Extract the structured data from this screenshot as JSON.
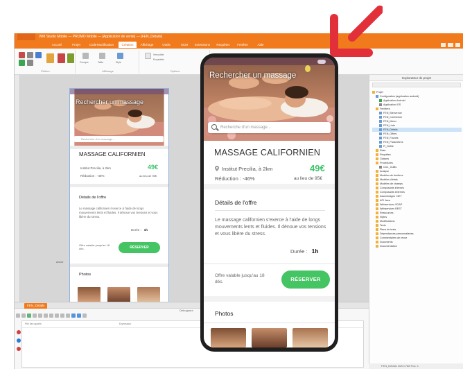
{
  "ide": {
    "window_title": "WM Studio Mobile — PROMO Mobile — [Application de vente] — [FEN_Détails]",
    "ribbon_tabs": [
      "Accueil",
      "Projet",
      "Code",
      "Modification",
      "Création",
      "Affichage",
      "Outils",
      "SCM",
      "Extensions",
      "Requêtes",
      "Fenêtre",
      "Aide"
    ],
    "ribbon_groups": [
      "Édition",
      "Affichage",
      "Mode",
      "Options"
    ],
    "ribbon_items": [
      "Aligner",
      "Distribuer",
      "Ordre",
      "Ancres",
      "Grouper",
      "Taille",
      "Style",
      "Verrouiller",
      "Propriétés",
      "Modèle"
    ],
    "anchor_label": "Ancre",
    "bottom_tab": "FEN_Détails",
    "debugger_label": "Débogueur",
    "code_columns": [
      "Pile des appels",
      "Expression",
      "Valeur"
    ],
    "status_text": "FEN_Détails   1024×768  Pos: 1"
  },
  "explorer": {
    "title": "Explorateur de projet",
    "tree": [
      {
        "label": "Projet",
        "indent": 0,
        "color": "#f0b23c"
      },
      {
        "label": "Configuration (application android)",
        "indent": 1,
        "color": "#6c9bd4"
      },
      {
        "label": "Application Android",
        "indent": 2,
        "color": "#3aa555"
      },
      {
        "label": "Application iOS",
        "indent": 2,
        "color": "#8a8a8a"
      },
      {
        "label": "Fenêtres",
        "indent": 1,
        "color": "#f0b23c"
      },
      {
        "label": "FEN_Bienvenue",
        "indent": 2,
        "color": "#6c9bd4"
      },
      {
        "label": "FEN_Connexion",
        "indent": 2,
        "color": "#6c9bd4"
      },
      {
        "label": "FEN_Menu",
        "indent": 2,
        "color": "#6c9bd4"
      },
      {
        "label": "FEN_Liste",
        "indent": 2,
        "color": "#6c9bd4"
      },
      {
        "label": "FEN_Détails",
        "indent": 2,
        "color": "#6c9bd4",
        "selected": true
      },
      {
        "label": "FEN_Offres",
        "indent": 2,
        "color": "#6c9bd4"
      },
      {
        "label": "FEN_Favoris",
        "indent": 2,
        "color": "#6c9bd4"
      },
      {
        "label": "FEN_Paramètres",
        "indent": 2,
        "color": "#6c9bd4"
      },
      {
        "label": "FI_Défilé",
        "indent": 2,
        "color": "#6c9bd4"
      },
      {
        "label": "Etats",
        "indent": 1,
        "color": "#f0b23c"
      },
      {
        "label": "Requêtes",
        "indent": 1,
        "color": "#f0b23c"
      },
      {
        "label": "Classes",
        "indent": 1,
        "color": "#f0b23c"
      },
      {
        "label": "Procédures",
        "indent": 1,
        "color": "#f0b23c"
      },
      {
        "label": "COL_Outils",
        "indent": 2,
        "color": "#8a8a8a"
      },
      {
        "label": "Analyse",
        "indent": 1,
        "color": "#f0b23c"
      },
      {
        "label": "Modèles de fenêtres",
        "indent": 1,
        "color": "#f0b23c"
      },
      {
        "label": "Modèles d'états",
        "indent": 1,
        "color": "#f0b23c"
      },
      {
        "label": "Modèles de champs",
        "indent": 1,
        "color": "#f0b23c"
      },
      {
        "label": "Composants internes",
        "indent": 1,
        "color": "#f0b23c"
      },
      {
        "label": "Composants externes",
        "indent": 1,
        "color": "#f0b23c"
      },
      {
        "label": "Assemblages .NET",
        "indent": 1,
        "color": "#f0b23c"
      },
      {
        "label": "API Java",
        "indent": 1,
        "color": "#f0b23c"
      },
      {
        "label": "Webservices SOAP",
        "indent": 1,
        "color": "#f0b23c"
      },
      {
        "label": "Webservices REST",
        "indent": 1,
        "color": "#f0b23c"
      },
      {
        "label": "Ressources",
        "indent": 1,
        "color": "#f0b23c"
      },
      {
        "label": "Styles",
        "indent": 1,
        "color": "#f0b23c"
      },
      {
        "label": "Modifications",
        "indent": 1,
        "color": "#f0b23c"
      },
      {
        "label": "Tests",
        "indent": 1,
        "color": "#f0b23c"
      },
      {
        "label": "Plans de tests",
        "indent": 1,
        "color": "#f0b23c"
      },
      {
        "label": "Dépendances personnalisées",
        "indent": 1,
        "color": "#f0b23c"
      },
      {
        "label": "Commentaires de revue",
        "indent": 1,
        "color": "#f0b23c"
      },
      {
        "label": "Documents",
        "indent": 1,
        "color": "#f0b23c"
      },
      {
        "label": "Documentation",
        "indent": 1,
        "color": "#f0b23c"
      }
    ]
  },
  "app": {
    "headline": "Rechercher un massage",
    "search_placeholder": "Recherche d'un massage...",
    "service_title": "MASSAGE CALIFORNIEN",
    "venue": "Institut Precilia, à 2km",
    "price": "49€",
    "discount": "Réduction : -46%",
    "original_price": "au lieu de 95€",
    "details_heading": "Détails de l'offre",
    "description": "Le massage californien s'exerce à l'aide de longs mouvements lents et fluides. Il dénoue vos tensions et vous libère du stress.",
    "duration_label": "Durée :",
    "duration_value": "1h",
    "validity": "Offre valable jusqu'au 18 déc.",
    "cta": "RÉSERVER",
    "photos_heading": "Photos"
  },
  "colors": {
    "accent": "#f07a1c",
    "price_green": "#3dc46a",
    "cta_green": "#44c463",
    "arrow_red": "#e2303a"
  }
}
